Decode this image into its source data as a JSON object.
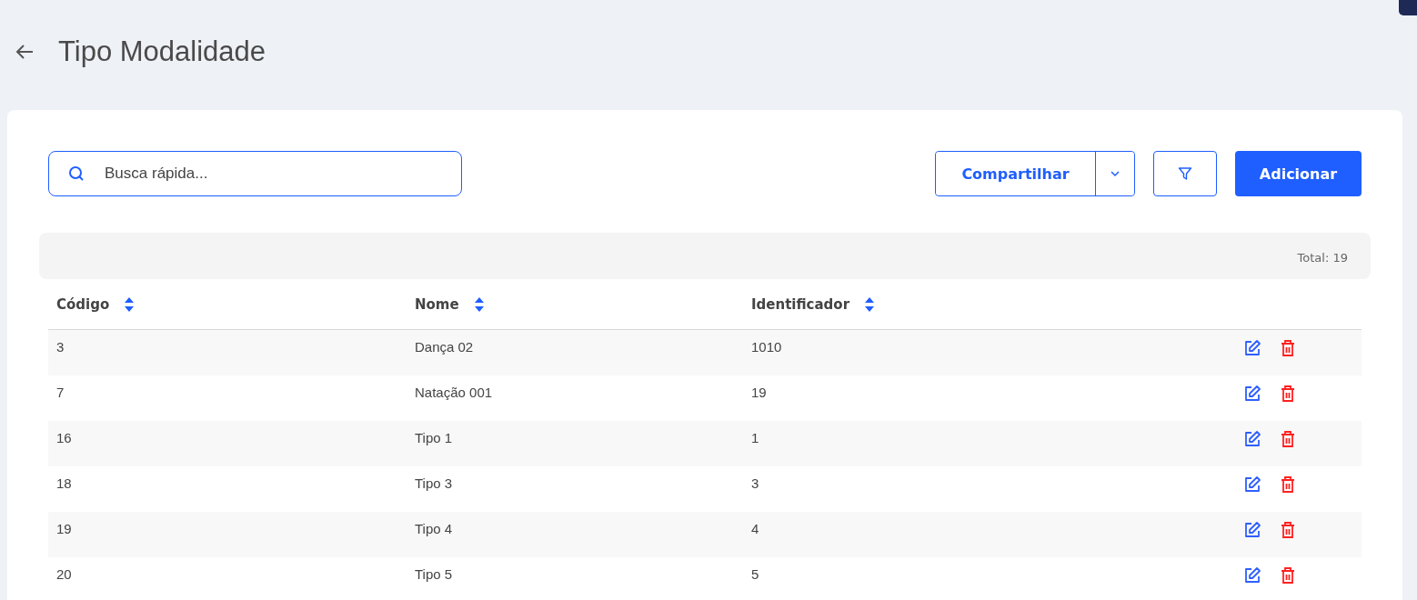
{
  "header": {
    "title": "Tipo Modalidade"
  },
  "search": {
    "placeholder": "Busca rápida..."
  },
  "buttons": {
    "share": "Compartilhar",
    "add": "Adicionar"
  },
  "total": "Total: 19",
  "table": {
    "columns": [
      "Código",
      "Nome",
      "Identificador"
    ],
    "rows": [
      {
        "cells": [
          "3",
          "Dança 02",
          "1010"
        ]
      },
      {
        "cells": [
          "7",
          "Natação 001",
          "19"
        ]
      },
      {
        "cells": [
          "16",
          "Tipo 1",
          "1"
        ]
      },
      {
        "cells": [
          "18",
          "Tipo 3",
          "3"
        ]
      },
      {
        "cells": [
          "19",
          "Tipo 4",
          "4"
        ]
      },
      {
        "cells": [
          "20",
          "Tipo 5",
          "5"
        ]
      }
    ]
  }
}
